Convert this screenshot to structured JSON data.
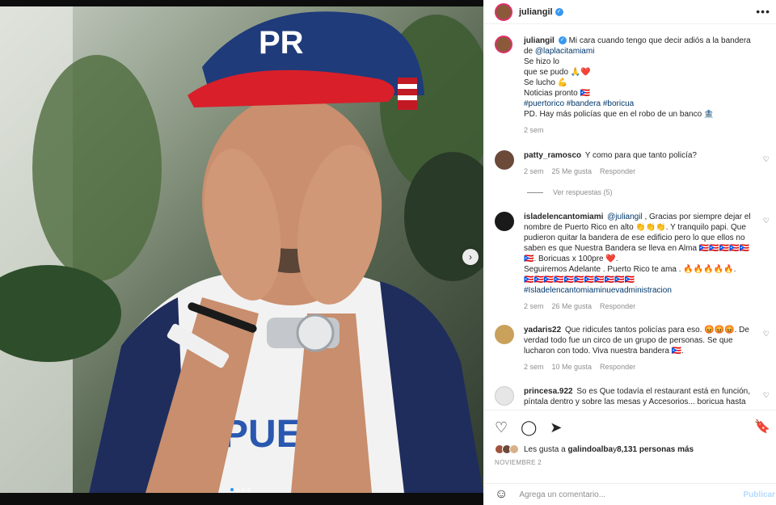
{
  "post": {
    "username": "juliangil",
    "verified": true
  },
  "photo": {
    "carousel_dots": 4,
    "active_dot": 0,
    "next_label": "›",
    "cap_text": "PR",
    "shirt_text": "PUE"
  },
  "caption": {
    "username": "juliangil",
    "text_prefix": "Mi cara cuando tengo que decir adiós a la bandera de ",
    "mention": "@laplacitamiami",
    "lines": [
      "Se hizo lo",
      "que se pudo 🙏❤️",
      "Se lucho 💪",
      "Noticias pronto 🇵🇷"
    ],
    "hashtags": "#puertorico #bandera #boricua",
    "ps": "PD. Hay más policías que en el robo de un banco 🏦",
    "time": "2 sem"
  },
  "comments": [
    {
      "username": "patty_ramosco",
      "text": "Y como para que tanto policía?",
      "time": "2 sem",
      "likes": "25 Me gusta",
      "reply": "Responder",
      "view_replies": "Ver respuestas (5)"
    },
    {
      "username": "isladelencantomiami",
      "mention": "@juliangil",
      "text_a": " , Gracias por siempre dejar el nombre de Puerto Rico en alto 👏👏👏. Y tranquilo papi. Que pudieron quitar la bandera de ese edificio pero lo que ellos no saben es que Nuestra Bandera se lleva en Alma 🇵🇷🇵🇷🇵🇷🇵🇷🇵🇷🇵🇷. Boricuas x 100pre ❤️.",
      "text_b": "Seguiremos Adelante . Puerto Rico te ama . 🔥🔥🔥🔥🔥.",
      "text_c": "🇵🇷🇵🇷🇵🇷🇵🇷🇵🇷🇵🇷🇵🇷🇵🇷🇵🇷🇵🇷🇵🇷",
      "hashtag": "#Isladelencantomiaminuevadministracion",
      "time": "2 sem",
      "likes": "26 Me gusta",
      "reply": "Responder"
    },
    {
      "username": "yadaris22",
      "text": "Que ridicules tantos policías para eso. 😡😡😡. De verdad todo fue un circo de un grupo de personas. Se que lucharon con todo. Viva nuestra bandera 🇵🇷.",
      "time": "2 sem",
      "likes": "10 Me gusta",
      "reply": "Responder"
    },
    {
      "username": "princesa.922",
      "text": "So es Que todavía el restaurant está en función, píntala dentro y sobre las mesas y Accesorios... boricua hasta"
    }
  ],
  "actions": {
    "likes_prefix": "Les gusta a ",
    "likes_user": "galindoalba",
    "likes_mid": " y ",
    "likes_count": "8,131 personas más",
    "date": "NOVIEMBRE 2"
  },
  "composer": {
    "placeholder": "Agrega un comentario...",
    "publish": "Publicar"
  },
  "colors": {
    "link": "#00376b",
    "verified": "#3897f0",
    "publish_disabled": "#b3dbff"
  }
}
